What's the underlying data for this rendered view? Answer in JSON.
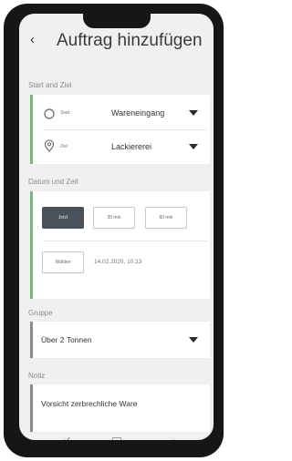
{
  "header": {
    "back_icon": "back-arrow-icon",
    "title": "Auftrag hinzufügen"
  },
  "start_ziel": {
    "label": "Start and Ziel",
    "start": {
      "icon": "circle-icon",
      "label": "Start",
      "value": "Wareneingang"
    },
    "ziel": {
      "icon": "location-pin-icon",
      "label": "Ziel",
      "value": "Lackiererei"
    }
  },
  "datum_zeit": {
    "label": "Datum und Zeit",
    "options": [
      "Jetzt",
      "30 min",
      "60 min"
    ],
    "other_button": "Wählen",
    "datetime": "14.02.2020, 10:13"
  },
  "gruppe": {
    "label": "Gruppe",
    "value": "Über 2 Tonnen"
  },
  "notiz": {
    "label": "Notiz",
    "value": "Vorsicht zerbrechliche Ware"
  },
  "colors": {
    "accent_green": "#69c36a",
    "accent_gray": "#8a8a8a",
    "button_active": "#49525a"
  },
  "navbar": {
    "icons": [
      "recent-apps-icon",
      "home-square-icon",
      "back-nav-icon"
    ]
  }
}
